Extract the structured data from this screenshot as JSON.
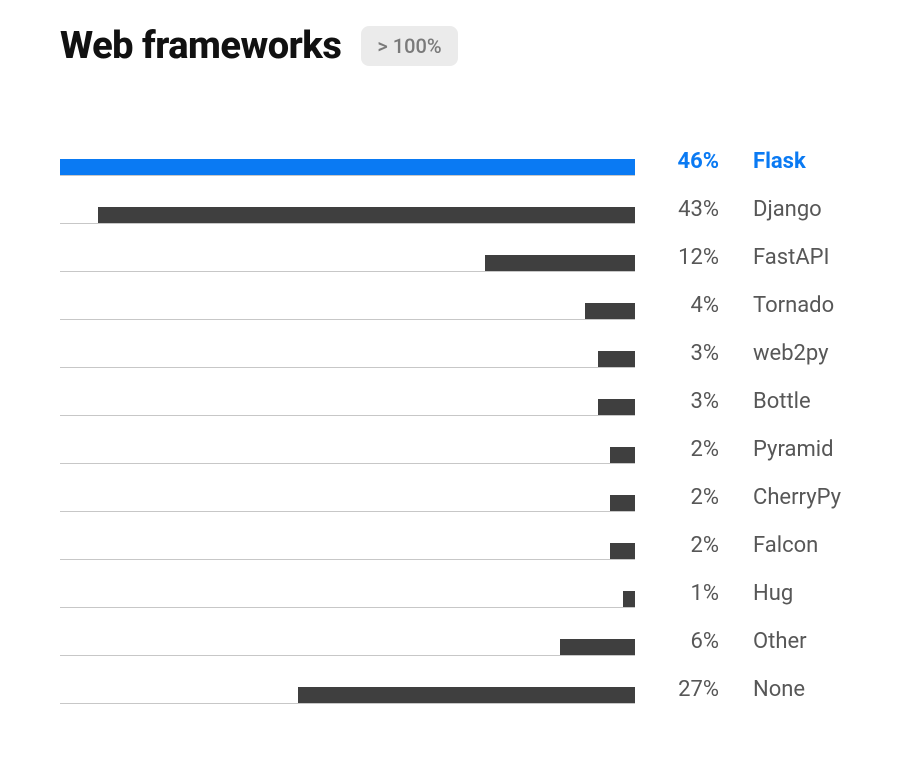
{
  "header": {
    "title": "Web frameworks",
    "badge": "> 100%"
  },
  "chart_data": {
    "type": "bar",
    "title": "Web frameworks",
    "xlabel": "",
    "ylabel": "",
    "xlim": [
      0,
      46
    ],
    "categories": [
      "Flask",
      "Django",
      "FastAPI",
      "Tornado",
      "web2py",
      "Bottle",
      "Pyramid",
      "CherryPy",
      "Falcon",
      "Hug",
      "Other",
      "None"
    ],
    "values": [
      46,
      43,
      12,
      4,
      3,
      3,
      2,
      2,
      2,
      1,
      6,
      27
    ],
    "highlight_index": 0,
    "value_suffix": "%",
    "colors": {
      "highlight": "#0a7af3",
      "default": "#3f3f3f"
    }
  }
}
